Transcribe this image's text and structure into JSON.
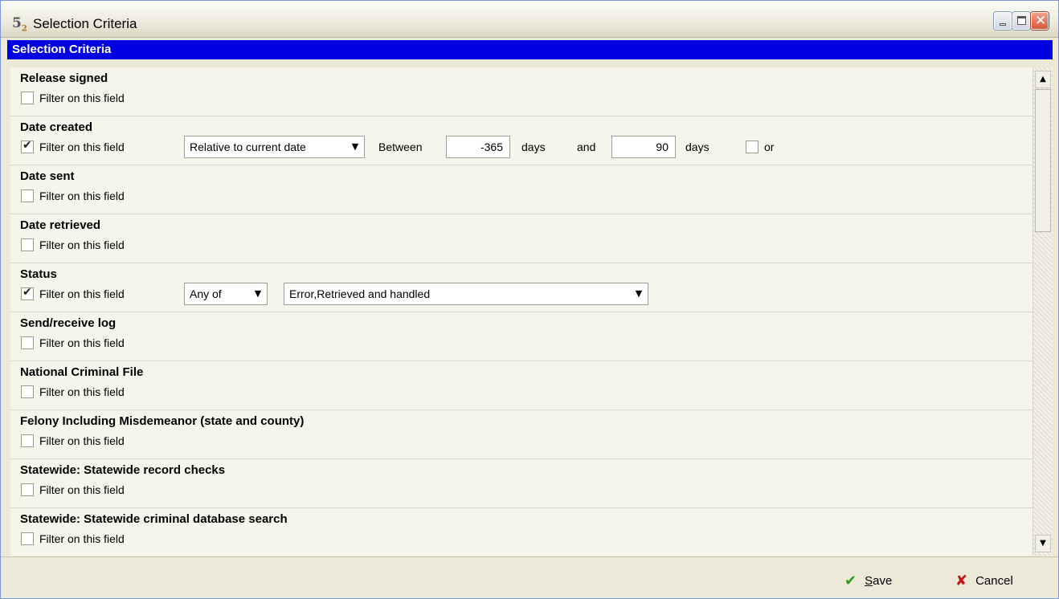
{
  "window": {
    "title": "Selection Criteria",
    "icon": "app-icon"
  },
  "section_header": "Selection Criteria",
  "filter_label": "Filter on this field",
  "rows": [
    {
      "title": "Release signed",
      "checked": false
    },
    {
      "title": "Date created",
      "checked": true
    },
    {
      "title": "Date sent",
      "checked": false
    },
    {
      "title": "Date retrieved",
      "checked": false
    },
    {
      "title": "Status",
      "checked": true
    },
    {
      "title": "Send/receive log",
      "checked": false
    },
    {
      "title": "National Criminal File",
      "checked": false
    },
    {
      "title": "Felony Including Misdemeanor (state and county)",
      "checked": false
    },
    {
      "title": "Statewide: Statewide record checks",
      "checked": false
    },
    {
      "title": "Statewide: Statewide criminal database search",
      "checked": false
    }
  ],
  "date_created": {
    "mode": "Relative to current date",
    "between_label": "Between",
    "from_value": "-365",
    "from_unit": "days",
    "and_label": "and",
    "to_value": "90",
    "to_unit": "days",
    "or_label": "or",
    "or_checked": false
  },
  "status": {
    "operator": "Any of",
    "values": "Error,Retrieved and handled"
  },
  "footer": {
    "save_prefix": "S",
    "save_rest": "ave",
    "cancel_label": "Cancel"
  },
  "colors": {
    "header_blue": "#0000e0",
    "save_icon": "#2e9a18",
    "cancel_icon": "#c41414"
  }
}
